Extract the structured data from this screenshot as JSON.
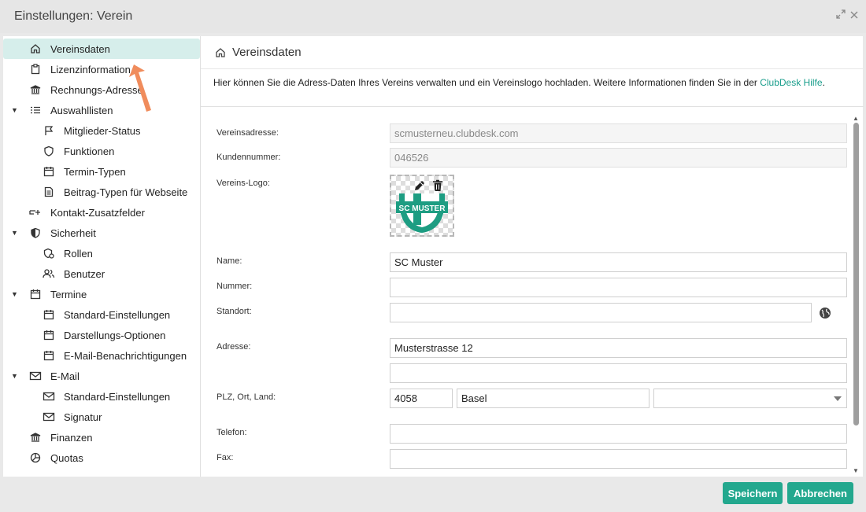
{
  "window": {
    "title": "Einstellungen: Verein",
    "maximize_icon": "expand-icon",
    "close_icon": "close-icon"
  },
  "sidebar": {
    "items": [
      {
        "label": "Vereinsdaten",
        "icon": "home-icon",
        "level": 0,
        "active": true
      },
      {
        "label": "Lizenzinformation",
        "icon": "clipboard-icon",
        "level": 0
      },
      {
        "label": "Rechnungs-Adresse",
        "icon": "bank-icon",
        "level": 0
      },
      {
        "label": "Auswahllisten",
        "icon": "list-icon",
        "level": 0,
        "expanded": true
      },
      {
        "label": "Mitglieder-Status",
        "icon": "flag-icon",
        "level": 1
      },
      {
        "label": "Funktionen",
        "icon": "shield-outline-icon",
        "level": 1
      },
      {
        "label": "Termin-Typen",
        "icon": "calendar-icon",
        "level": 1
      },
      {
        "label": "Beitrag-Typen für Webseite",
        "icon": "document-icon",
        "level": 1
      },
      {
        "label": "Kontakt-Zusatzfelder",
        "icon": "add-field-icon",
        "level": 0
      },
      {
        "label": "Sicherheit",
        "icon": "shield-icon",
        "level": 0,
        "expanded": true
      },
      {
        "label": "Rollen",
        "icon": "role-icon",
        "level": 1
      },
      {
        "label": "Benutzer",
        "icon": "users-icon",
        "level": 1
      },
      {
        "label": "Termine",
        "icon": "calendar-icon",
        "level": 0,
        "expanded": true
      },
      {
        "label": "Standard-Einstellungen",
        "icon": "calendar-icon",
        "level": 1
      },
      {
        "label": "Darstellungs-Optionen",
        "icon": "calendar-icon",
        "level": 1
      },
      {
        "label": "E-Mail-Benachrichtigungen",
        "icon": "calendar-icon",
        "level": 1
      },
      {
        "label": "E-Mail",
        "icon": "mail-icon",
        "level": 0,
        "expanded": true
      },
      {
        "label": "Standard-Einstellungen",
        "icon": "mail-icon",
        "level": 1
      },
      {
        "label": "Signatur",
        "icon": "mail-icon",
        "level": 1
      },
      {
        "label": "Finanzen",
        "icon": "bank-icon",
        "level": 0
      },
      {
        "label": "Quotas",
        "icon": "pie-icon",
        "level": 0
      }
    ]
  },
  "main": {
    "header": "Vereinsdaten",
    "intro": "Hier können Sie die Adress-Daten Ihres Vereins verwalten und ein Vereinslogo hochladen. Weitere Informationen finden Sie in der ",
    "intro_link": "ClubDesk Hilfe",
    "intro_end": ".",
    "fields": {
      "vereinsadresse_label": "Vereinsadresse:",
      "vereinsadresse_value": "scmusterneu.clubdesk.com",
      "kundennummer_label": "Kundennummer:",
      "kundennummer_value": "046526",
      "logo_label": "Vereins-Logo:",
      "logo_text": "SC MUSTER",
      "name_label": "Name:",
      "name_value": "SC Muster",
      "nummer_label": "Nummer:",
      "nummer_value": "",
      "standort_label": "Standort:",
      "standort_value": "",
      "adresse_label": "Adresse:",
      "adresse1_value": "Musterstrasse 12",
      "adresse2_value": "",
      "plz_label": "PLZ, Ort, Land:",
      "plz_value": "4058",
      "ort_value": "Basel",
      "land_value": "",
      "telefon_label": "Telefon:",
      "telefon_value": "",
      "fax_label": "Fax:",
      "fax_value": ""
    }
  },
  "footer": {
    "save_label": "Speichern",
    "cancel_label": "Abbrechen"
  },
  "colors": {
    "accent": "#23a88e",
    "active_bg": "#d6eeeb",
    "link": "#1a9e8c"
  }
}
